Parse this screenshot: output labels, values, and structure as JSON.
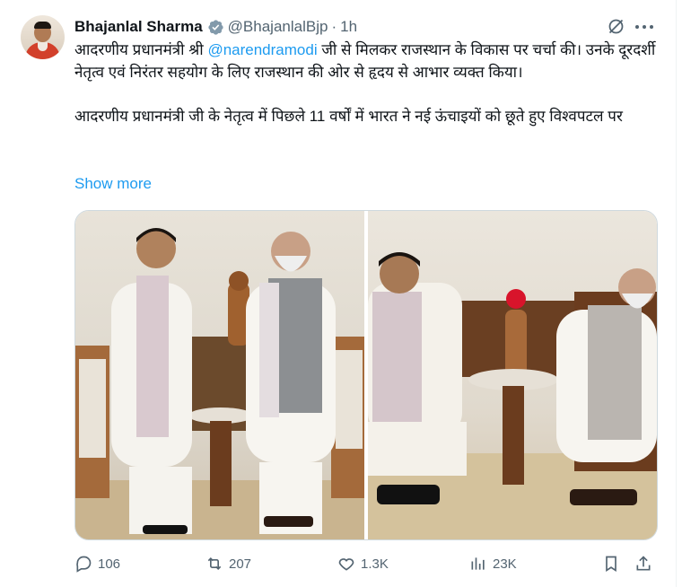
{
  "author": {
    "name": "Bhajanlal Sharma",
    "handle": "@BhajanlalBjp",
    "separator": "·",
    "time": "1h"
  },
  "tweet": {
    "text1_before": "आदरणीय प्रधानमंत्री श्री ",
    "mention": "@narendramodi",
    "text1_after": " जी से मिलकर राजस्थान के विकास पर चर्चा की। उनके दूरदर्शी नेतृत्व एवं निरंतर सहयोग के लिए राजस्थान की ओर से हृदय से आभार व्यक्त किया।",
    "text2": "आदरणीय प्रधानमंत्री जी के नेतृत्व में पिछले 11 वर्षों में भारत ने नई ऊंचाइयों को छूते हुए विश्वपटल पर",
    "show_more": "Show more"
  },
  "stats": {
    "replies": "106",
    "reposts": "207",
    "likes": "1.3K",
    "views": "23K"
  },
  "icons": {
    "verified": "verified-badge-icon",
    "grok": "grok-icon",
    "more": "more-icon",
    "reply": "reply-icon",
    "repost": "repost-icon",
    "like": "like-icon",
    "views": "views-icon",
    "bookmark": "bookmark-icon",
    "share": "share-icon"
  },
  "colors": {
    "accent": "#1d9bf0",
    "secondary_text": "#536471",
    "primary_text": "#0f1419"
  }
}
